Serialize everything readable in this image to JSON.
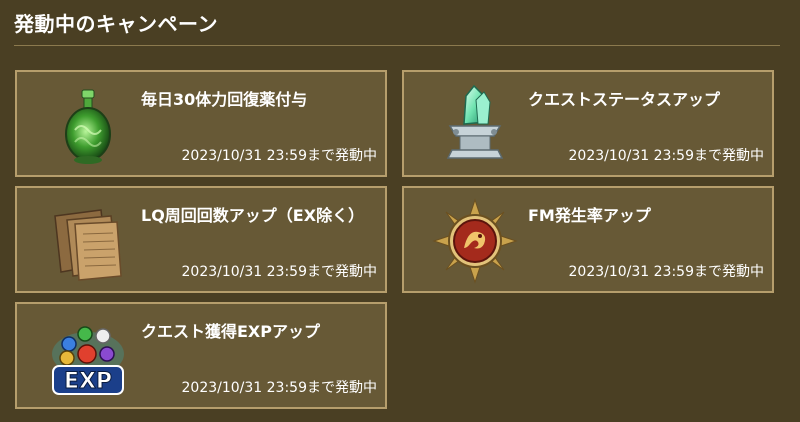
{
  "header": {
    "title": "発動中のキャンペーン"
  },
  "campaigns": [
    {
      "title": "毎日30体力回復薬付与",
      "status": "2023/10/31 23:59まで発動中",
      "icon": "green-potion-icon"
    },
    {
      "title": "クエストステータスアップ",
      "status": "2023/10/31 23:59まで発動中",
      "icon": "crystal-pedestal-icon"
    },
    {
      "title": "LQ周回回数アップ（EX除く）",
      "status": "2023/10/31 23:59まで発動中",
      "icon": "parchment-scroll-icon"
    },
    {
      "title": "FM発生率アップ",
      "status": "2023/10/31 23:59まで発動中",
      "icon": "fire-medal-icon"
    },
    {
      "title": "クエスト獲得EXPアップ",
      "status": "2023/10/31 23:59まで発動中",
      "icon": "exp-orbs-icon",
      "icon_text": "EXP"
    }
  ]
}
